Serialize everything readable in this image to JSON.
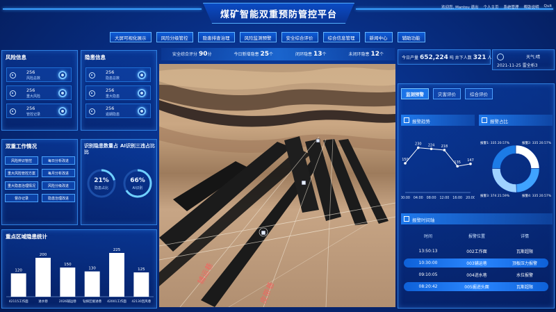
{
  "header": {
    "title": "煤矿智能双重预防管控平台",
    "welcome": "欢迎您, Mantou 退出",
    "links": [
      "个人主页",
      "系统管理",
      "帮助说明",
      "Quit"
    ]
  },
  "nav": [
    "大屏可视化展示",
    "风险分级管控",
    "隐患排查治理",
    "风险监测预警",
    "安全综合评价",
    "综合信息管理",
    "新闻中心",
    "辅助功能"
  ],
  "risk_panel": {
    "title": "风险信息",
    "items": [
      {
        "value": "256",
        "label": "风险总数"
      },
      {
        "value": "256",
        "label": "重大风险"
      },
      {
        "value": "256",
        "label": "管控记录"
      }
    ]
  },
  "hazard_panel": {
    "title": "隐患信息",
    "items": [
      {
        "value": "256",
        "label": "隐患总数"
      },
      {
        "value": "256",
        "label": "重大隐患"
      },
      {
        "value": "256",
        "label": "逾期隐患"
      }
    ]
  },
  "work_panel": {
    "title": "双重工作情况",
    "buttons": [
      "风险辨识管控",
      "每日分析改进",
      "重大风险管控方案",
      "每月分析改进",
      "重大隐患治理情况",
      "风险分级改进",
      "督办记录",
      "隐患治理改进"
    ]
  },
  "ratio_panel": {
    "title1": "识别隐患数量占比",
    "title2": "AI识别三违占比",
    "donut1": {
      "value": "21%",
      "label": "隐患占比",
      "fraction": 0.21
    },
    "donut2": {
      "value": "66%",
      "label": "AI识别",
      "fraction": 0.66
    }
  },
  "stat_strip": [
    {
      "label": "安全综合评分",
      "value": "90",
      "unit": "分"
    },
    {
      "label": "今日新增隐患",
      "value": "25",
      "unit": "个"
    },
    {
      "label": "闭环隐患",
      "value": "13",
      "unit": "个"
    },
    {
      "label": "未闭环隐患",
      "value": "12",
      "unit": "个"
    }
  ],
  "production": {
    "label1": "今日产量",
    "value1": "652,224",
    "unit1": "吨",
    "label2": "井下人数",
    "value2": "321",
    "unit2": "人"
  },
  "weather": {
    "text": "天气:",
    "state": "晴",
    "date": "2021-11-25",
    "extra": "雷全析3"
  },
  "right_tabs": [
    "监测预警",
    "灾害评价",
    "综合评价"
  ],
  "alarm_trend": {
    "title": "报警趋势",
    "chart_data": {
      "type": "line",
      "categories": [
        "00:00",
        "04:00",
        "08:00",
        "12:00",
        "16:00",
        "20:00"
      ],
      "values": [
        150,
        230,
        224,
        218,
        135,
        147
      ],
      "ylim": [
        0,
        300
      ]
    }
  },
  "alarm_ratio": {
    "title": "报警占比",
    "chart_data": {
      "type": "pie",
      "labels": [
        "报警1: 335 20.57%",
        "报警2: 335 20.57%",
        "报警3: 374 21.59%",
        "报警4: 335 20.57%"
      ],
      "values": [
        20.57,
        20.57,
        21.59,
        20.57
      ]
    }
  },
  "alarm_table": {
    "title": "报警时间轴",
    "headers": [
      "时间",
      "报警位置",
      "详情"
    ],
    "rows": [
      [
        "13:50:13",
        "002工作面",
        "瓦斯超限"
      ],
      [
        "10:30:00",
        "003辅运巷",
        "顶板压力报警"
      ],
      [
        "09:10:05",
        "004进水巷",
        "水位报警"
      ],
      [
        "08:20:42",
        "005掘进头面",
        "瓦斯超限"
      ]
    ]
  },
  "district_panel": {
    "title": "重点区域隐患统计",
    "chart_data": {
      "type": "bar",
      "categories": [
        "42115工作面",
        "进水巷",
        "2026辅运巷",
        "钻探区掘进巷",
        "42001工作面",
        "42130回风巷"
      ],
      "values": [
        120,
        200,
        150,
        130,
        225,
        125
      ],
      "ylim": [
        0,
        250
      ]
    }
  },
  "scene": {
    "labels": [
      "辅运巷",
      "皮带巷"
    ]
  },
  "colors": {
    "accent": "#2f7fe0",
    "bg": "#072a7a",
    "highlight": "#2a86ff"
  }
}
